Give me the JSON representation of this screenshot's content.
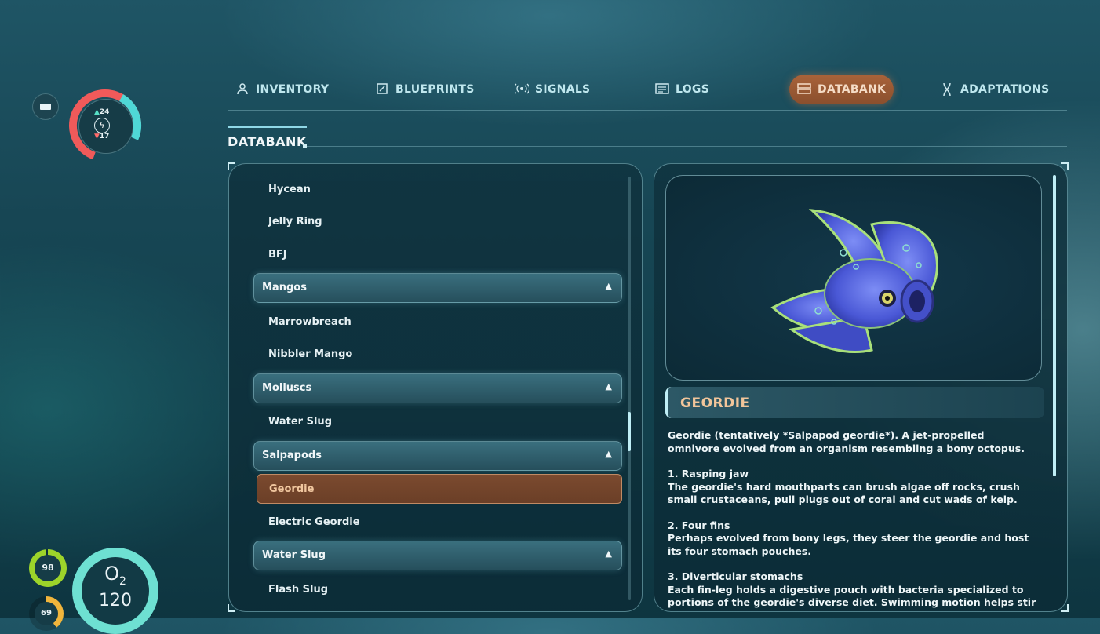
{
  "hud": {
    "food": "24",
    "water": "17",
    "health": "98",
    "food2": "69",
    "oxygen_label": "O",
    "oxygen_sub": "2",
    "oxygen_value": "120"
  },
  "tabs": [
    {
      "label": "INVENTORY",
      "icon": "person-icon"
    },
    {
      "label": "BLUEPRINTS",
      "icon": "blueprint-icon"
    },
    {
      "label": "SIGNALS",
      "icon": "signal-icon"
    },
    {
      "label": "LOGS",
      "icon": "logs-icon"
    },
    {
      "label": "DATABANK",
      "icon": "databank-icon",
      "active": true
    },
    {
      "label": "ADAPTATIONS",
      "icon": "dna-icon"
    }
  ],
  "section_title": "DATABANK",
  "list": {
    "items": [
      {
        "type": "item",
        "label": "Hycean"
      },
      {
        "type": "item",
        "label": "Jelly Ring"
      },
      {
        "type": "item",
        "label": "BFJ"
      },
      {
        "type": "category",
        "label": "Mangos"
      },
      {
        "type": "item",
        "label": "Marrowbreach"
      },
      {
        "type": "item",
        "label": "Nibbler Mango"
      },
      {
        "type": "category",
        "label": "Molluscs"
      },
      {
        "type": "item",
        "label": "Water Slug"
      },
      {
        "type": "category",
        "label": "Salpapods"
      },
      {
        "type": "selected",
        "label": "Geordie"
      },
      {
        "type": "item",
        "label": "Electric Geordie"
      },
      {
        "type": "category",
        "label": "Water Slug"
      },
      {
        "type": "item",
        "label": "Flash Slug"
      }
    ]
  },
  "detail": {
    "name": "GEORDIE",
    "intro": "Geordie (tentatively *Salpapod geordie*). A jet-propelled omnivore evolved from an organism resembling a bony octopus.",
    "sections": [
      {
        "heading": "1. Rasping jaw",
        "body": "The geordie's hard mouthparts can brush algae off rocks, crush small crustaceans, pull plugs out of coral and cut wads of kelp."
      },
      {
        "heading": "2. Four fins",
        "body": "Perhaps evolved from bony legs, they steer the geordie and host its four stomach pouches."
      },
      {
        "heading": "3. Diverticular stomachs",
        "body": "Each fin-leg holds a digestive pouch with bacteria specialized to portions of the geordie's diverse diet. Swimming motion helps stir and"
      }
    ]
  }
}
